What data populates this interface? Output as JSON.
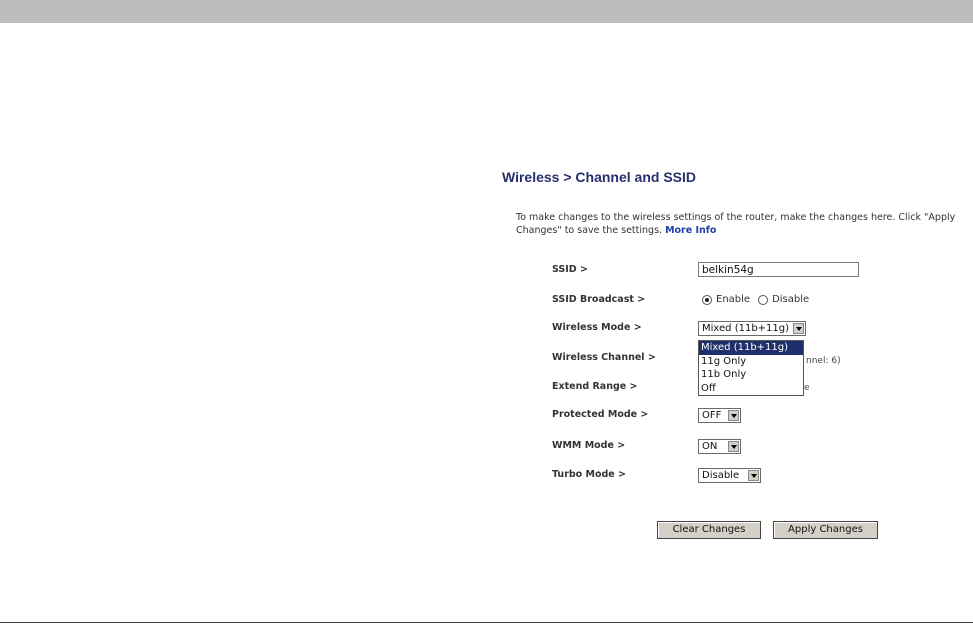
{
  "page": {
    "title": "Wireless > Channel and SSID",
    "description": "To make changes to the wireless settings of the router, make the changes here. Click \"Apply Changes\" to save the settings.",
    "more_info_link": "More Info"
  },
  "form": {
    "ssid": {
      "label": "SSID >",
      "value": "belkin54g"
    },
    "ssid_broadcast": {
      "label": "SSID Broadcast >",
      "enable_label": "Enable",
      "disable_label": "Disable",
      "selected": "Enable"
    },
    "wireless_mode": {
      "label": "Wireless Mode >",
      "value": "Mixed (11b+11g)",
      "options": [
        "Mixed (11b+11g)",
        "11g Only",
        "11b Only",
        "Off"
      ],
      "highlighted": "Mixed (11b+11g)"
    },
    "wireless_channel": {
      "label": "Wireless Channel >",
      "partial_text": "nnel: 6)"
    },
    "extend_range": {
      "label": "Extend Range >",
      "partial_text": "e"
    },
    "protected_mode": {
      "label": "Protected Mode >",
      "value": "OFF"
    },
    "wmm_mode": {
      "label": "WMM Mode >",
      "value": "ON"
    },
    "turbo_mode": {
      "label": "Turbo Mode >",
      "value": "Disable"
    }
  },
  "buttons": {
    "clear": "Clear Changes",
    "apply": "Apply Changes"
  }
}
